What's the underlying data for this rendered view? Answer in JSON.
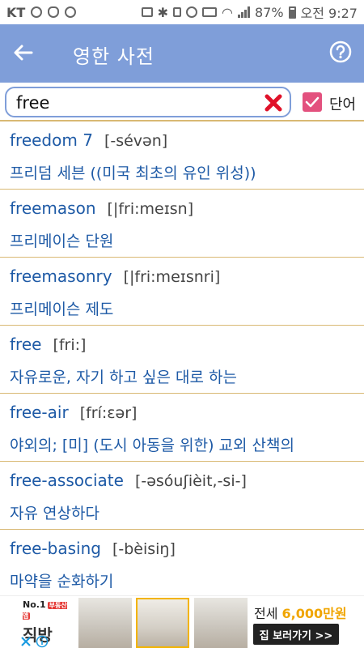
{
  "status_bar": {
    "carrier": "KT",
    "battery": "87%",
    "time": "오전 9:27",
    "icons": [
      "chrome-icon",
      "butterfly-icon",
      "refresh-icon",
      "cast-icon",
      "bluetooth-icon",
      "mute-icon",
      "alarm-icon",
      "hd-icon",
      "wifi-icon",
      "signal-icon",
      "battery-icon"
    ]
  },
  "header": {
    "title": "영한 사전",
    "back_icon": "arrow-left-icon",
    "help_icon": "question-icon"
  },
  "search": {
    "value": "free",
    "clear_icon": "close-x-icon",
    "word_checkbox_checked": true,
    "word_label": "단어"
  },
  "results": [
    {
      "word": "freedom 7",
      "pron": "[-sévən]",
      "meaning": "프리덤 세븐 ((미국 최초의 유인 위성))"
    },
    {
      "word": "freemason",
      "pron": "[|fri:meɪsn]",
      "meaning": "프리메이슨 단원"
    },
    {
      "word": "freemasonry",
      "pron": "[|fri:meɪsnri]",
      "meaning": "프리메이슨 제도"
    },
    {
      "word": "free",
      "pron": "[fri:]",
      "meaning": "자유로운, 자기 하고 싶은 대로 하는"
    },
    {
      "word": "free-air",
      "pron": "[frí:ɛər]",
      "meaning": "야외의; [미] (도시 아동을 위한) 교외 산책의"
    },
    {
      "word": "free-associate",
      "pron": "[-əsóuʃièit,-si-]",
      "meaning": "자유 연상하다"
    },
    {
      "word": "free-basing",
      "pron": "[-bèisiŋ]",
      "meaning": "마약을 순화하기"
    }
  ],
  "ad": {
    "badge": "No.1",
    "badge_tag": "부동산앱",
    "brand": "직방",
    "price_prefix": "전세 ",
    "price_value": "6,000만원",
    "cta": "집 보러가기 >>"
  },
  "colors": {
    "header_bg": "#7f9ed9",
    "link_blue": "#1e5aa6",
    "divider": "#d9b974",
    "checkbox": "#e3517e",
    "clear_x": "#e0122a"
  }
}
